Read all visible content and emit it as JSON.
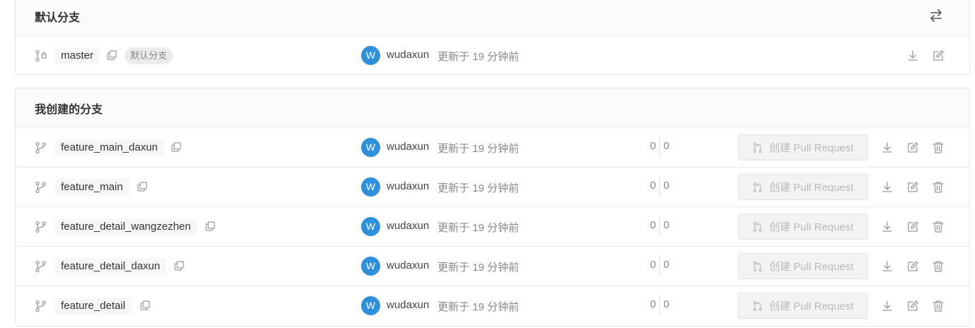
{
  "default_section": {
    "title": "默认分支",
    "branch": {
      "name": "master",
      "badge": "默认分支",
      "avatar_letter": "W",
      "author": "wudaxun",
      "updated": "更新于 19 分钟前"
    }
  },
  "my_section": {
    "title": "我创建的分支",
    "pr_label": "创建 Pull Request",
    "branches": [
      {
        "name": "feature_main_daxun",
        "avatar_letter": "W",
        "author": "wudaxun",
        "updated": "更新于 19 分钟前",
        "ahead": "0",
        "behind": "0"
      },
      {
        "name": "feature_main",
        "avatar_letter": "W",
        "author": "wudaxun",
        "updated": "更新于 19 分钟前",
        "ahead": "0",
        "behind": "0"
      },
      {
        "name": "feature_detail_wangzezhen",
        "avatar_letter": "W",
        "author": "wudaxun",
        "updated": "更新于 19 分钟前",
        "ahead": "0",
        "behind": "0"
      },
      {
        "name": "feature_detail_daxun",
        "avatar_letter": "W",
        "author": "wudaxun",
        "updated": "更新于 19 分钟前",
        "ahead": "0",
        "behind": "0"
      },
      {
        "name": "feature_detail",
        "avatar_letter": "W",
        "author": "wudaxun",
        "updated": "更新于 19 分钟前",
        "ahead": "0",
        "behind": "0"
      }
    ]
  },
  "colors": {
    "avatar": "#2f8fd8",
    "icon": "#999999"
  }
}
